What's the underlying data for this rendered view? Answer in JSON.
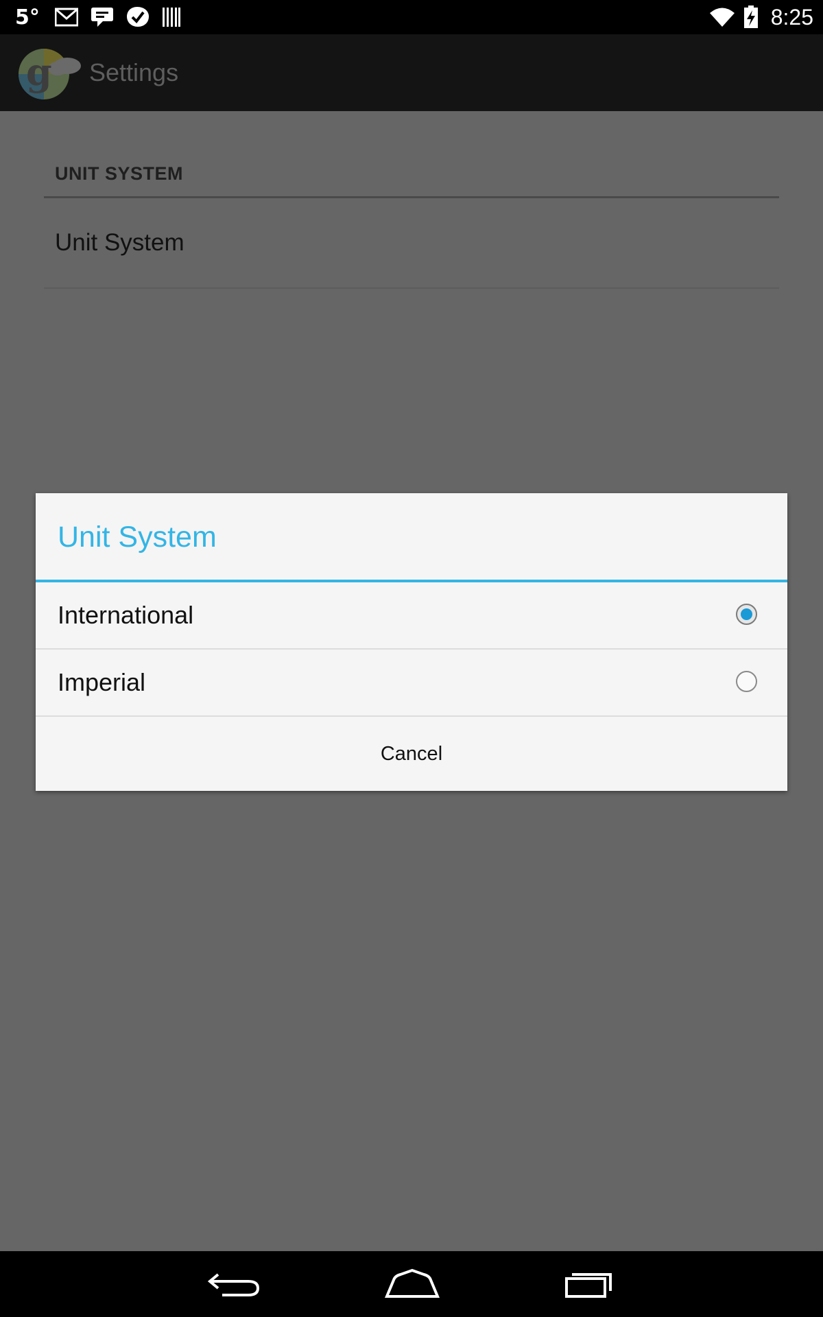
{
  "status_bar": {
    "temperature": "5°",
    "time": "8:25",
    "left_icons": [
      "gmail-icon",
      "hangouts-icon",
      "tasks-check-icon",
      "barcode-icon"
    ],
    "right_icons": [
      "wifi-icon",
      "battery-charging-icon"
    ]
  },
  "action_bar": {
    "title": "Settings",
    "logo_icon": "weather-app-logo"
  },
  "settings": {
    "section_header": "UNIT SYSTEM",
    "preference_title": "Unit System"
  },
  "dialog": {
    "title": "Unit System",
    "options": [
      {
        "label": "International",
        "selected": true
      },
      {
        "label": "Imperial",
        "selected": false
      }
    ],
    "cancel_label": "Cancel",
    "accent_color": "#33b5e5"
  },
  "nav_bar": {
    "buttons": [
      "back-icon",
      "home-icon",
      "recents-icon"
    ]
  }
}
